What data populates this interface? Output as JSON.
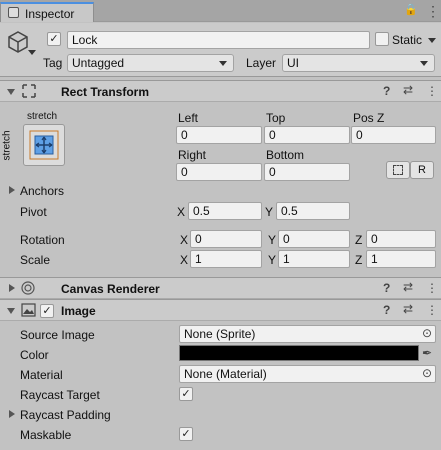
{
  "window": {
    "tab_label": "Inspector"
  },
  "object": {
    "name": "Lock",
    "static_label": "Static",
    "tag_label": "Tag",
    "tag_value": "Untagged",
    "layer_label": "Layer",
    "layer_value": "UI"
  },
  "rect_transform": {
    "title": "Rect Transform",
    "anchor_preset_label": "stretch",
    "anchor_preset_vlabel": "stretch",
    "left_label": "Left",
    "left_value": "0",
    "top_label": "Top",
    "top_value": "0",
    "posz_label": "Pos Z",
    "posz_value": "0",
    "right_label": "Right",
    "right_value": "0",
    "bottom_label": "Bottom",
    "bottom_value": "0",
    "raw_button": "R",
    "anchors_label": "Anchors",
    "pivot_label": "Pivot",
    "pivot_x_label": "X",
    "pivot_x": "0.5",
    "pivot_y_label": "Y",
    "pivot_y": "0.5",
    "rotation_label": "Rotation",
    "rot_x_label": "X",
    "rot_x": "0",
    "rot_y_label": "Y",
    "rot_y": "0",
    "rot_z_label": "Z",
    "rot_z": "0",
    "scale_label": "Scale",
    "scale_x_label": "X",
    "scale_x": "1",
    "scale_y_label": "Y",
    "scale_y": "1",
    "scale_z_label": "Z",
    "scale_z": "1"
  },
  "canvas_renderer": {
    "title": "Canvas Renderer"
  },
  "image": {
    "title": "Image",
    "source_image_label": "Source Image",
    "source_image_value": "None (Sprite)",
    "color_label": "Color",
    "color_value": "#000000",
    "material_label": "Material",
    "material_value": "None (Material)",
    "raycast_target_label": "Raycast Target",
    "raycast_target_check": "✓",
    "raycast_padding_label": "Raycast Padding",
    "maskable_label": "Maskable",
    "maskable_check": "✓"
  },
  "icons": {
    "lock": "🔒",
    "menu": "⋮",
    "help": "?",
    "presets": "⇄",
    "more": "⋮",
    "gameobject_check": "✓",
    "image_check": "✓",
    "target": "⊙",
    "eyedropper": "✒"
  },
  "colors": {
    "accent": "#4b8fe0",
    "background": "#c2c2c2",
    "header": "#cbcbcb",
    "field": "#f1f1f1"
  }
}
